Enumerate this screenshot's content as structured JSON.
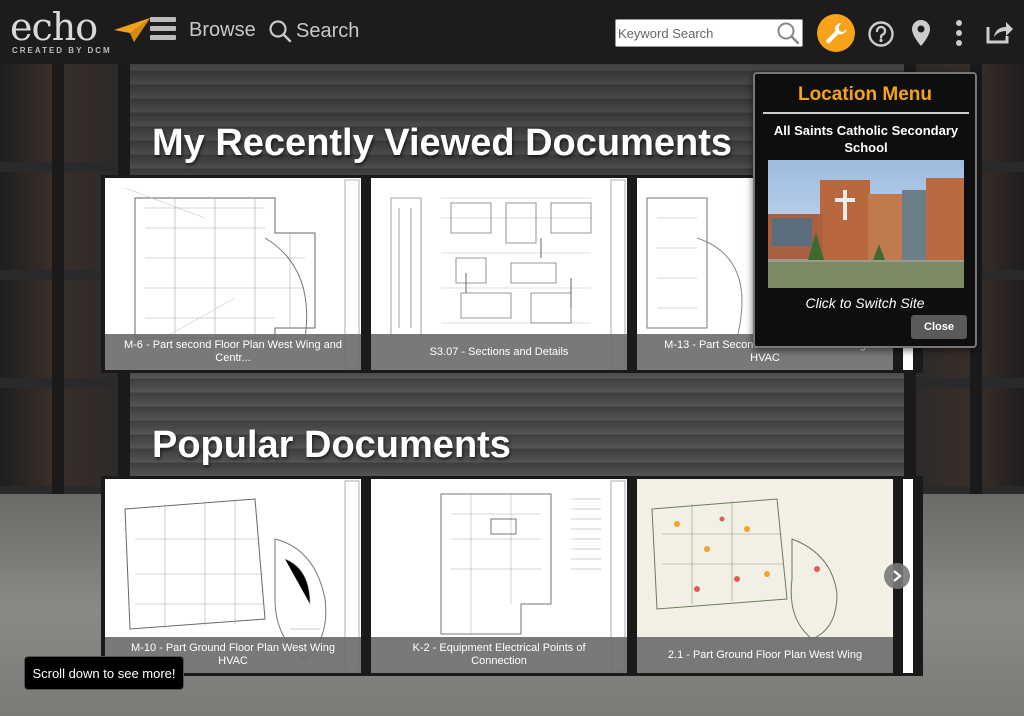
{
  "header": {
    "logo_word": "echo",
    "logo_sub": "CREATED BY DCM",
    "browse_label": "Browse",
    "search_label": "Search",
    "keyword_placeholder": "Keyword Search",
    "accent_color": "#f7a21b"
  },
  "recent": {
    "title": "My Recently Viewed Documents",
    "docs": [
      {
        "caption": "M-6 - Part second Floor Plan West Wing and Centr..."
      },
      {
        "caption": "S3.07 - Sections and Details"
      },
      {
        "caption": "M-13 - Part Second Floor Plan East Wing HVAC"
      }
    ]
  },
  "popular": {
    "title": "Popular Documents",
    "docs": [
      {
        "caption": "M-10 - Part Ground Floor Plan West Wing HVAC"
      },
      {
        "caption": "K-2 - Equipment Electrical Points of Connection"
      },
      {
        "caption": "2.1 - Part Ground Floor Plan West Wing"
      }
    ]
  },
  "location_menu": {
    "title": "Location Menu",
    "school": "All Saints Catholic Secondary School",
    "switch_label": "Click to Switch Site",
    "close_label": "Close"
  },
  "toast": "Scroll down to see more!"
}
